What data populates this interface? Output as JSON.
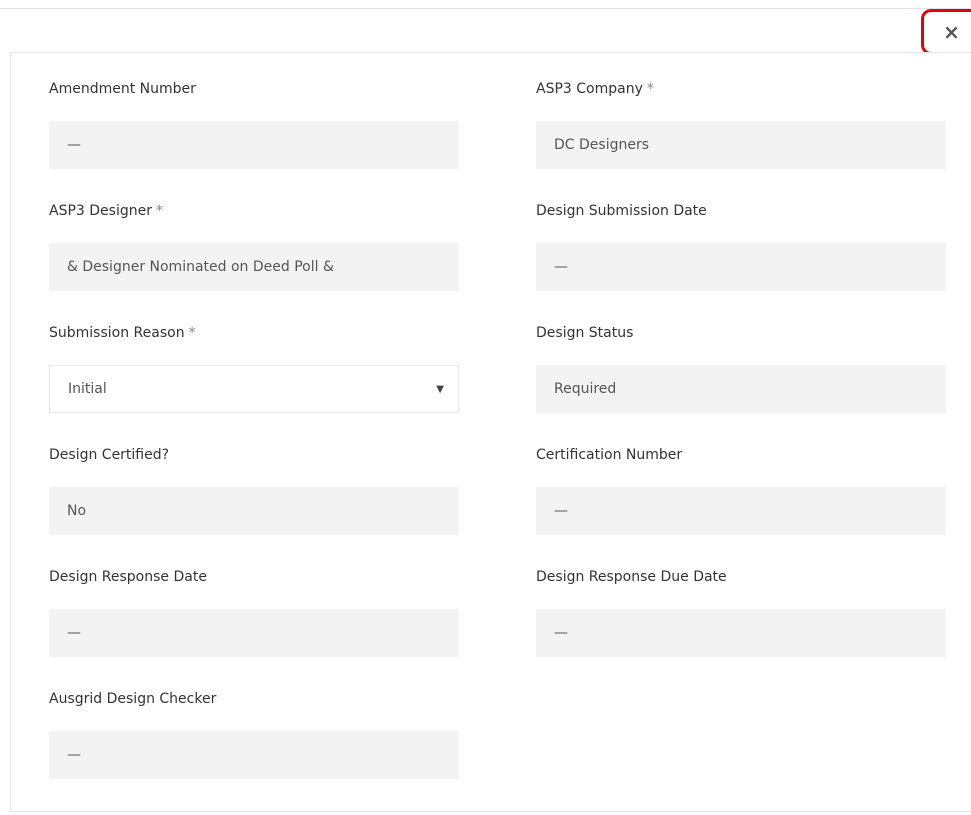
{
  "dialog": {
    "close_label": "×"
  },
  "fields": {
    "amendment_number": {
      "label": "Amendment Number",
      "value": "—"
    },
    "asp3_company": {
      "label": "ASP3 Company",
      "required": "*",
      "value": "DC Designers"
    },
    "asp3_designer": {
      "label": "ASP3 Designer",
      "required": "*",
      "value": "& Designer Nominated on Deed Poll &"
    },
    "design_submission_date": {
      "label": "Design Submission Date",
      "value": "—"
    },
    "submission_reason": {
      "label": "Submission Reason",
      "required": "*",
      "value": "Initial",
      "caret": "▼"
    },
    "design_status": {
      "label": "Design Status",
      "value": "Required"
    },
    "design_certified": {
      "label": "Design Certified?",
      "value": "No"
    },
    "certification_number": {
      "label": "Certification Number",
      "value": "—"
    },
    "design_response_date": {
      "label": "Design Response Date",
      "value": "—"
    },
    "design_response_due_date": {
      "label": "Design Response Due Date",
      "value": "—"
    },
    "ausgrid_design_checker": {
      "label": "Ausgrid Design Checker",
      "value": "—"
    }
  }
}
